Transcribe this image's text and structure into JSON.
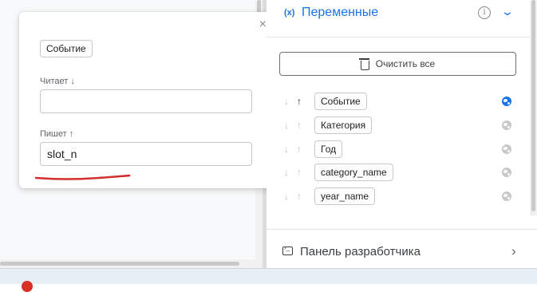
{
  "popup": {
    "chip": "Событие",
    "reads_label": "Читает ↓",
    "reads_value": "",
    "writes_label": "Пишет ↑",
    "writes_value": "slot_n",
    "close": "×"
  },
  "variables_panel": {
    "title": "Переменные",
    "var_icon": "(x)",
    "info_icon": "i",
    "collapse_icon": "chevron-down-icon",
    "clear_button": "Очистить все",
    "items": [
      {
        "name": "Событие",
        "read_arrow": "↓",
        "write_arrow": "↑",
        "write_active": true,
        "global": true
      },
      {
        "name": "Категория",
        "read_arrow": "↓",
        "write_arrow": "↑",
        "write_active": false,
        "global": false
      },
      {
        "name": "Год",
        "read_arrow": "↓",
        "write_arrow": "↑",
        "write_active": false,
        "global": false
      },
      {
        "name": "category_name",
        "read_arrow": "↓",
        "write_arrow": "↑",
        "write_active": false,
        "global": false
      },
      {
        "name": "year_name",
        "read_arrow": "↓",
        "write_arrow": "↑",
        "write_active": false,
        "global": false
      }
    ]
  },
  "dev_panel": {
    "label": "Панель разработчика",
    "chevron": "›"
  },
  "colors": {
    "accent": "#1a73e8",
    "underline": "#d32f2f",
    "alert": "#d93025"
  }
}
